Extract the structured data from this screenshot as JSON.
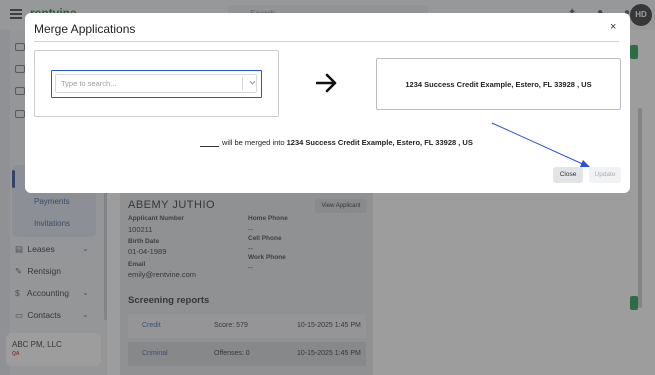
{
  "app": {
    "brand": "rentvine",
    "search_placeholder": "Search",
    "search_shortcut": "⌘K",
    "user_initials": "HD"
  },
  "sidebar": {
    "sub_items": [
      {
        "label": "Payments"
      },
      {
        "label": "Invitations"
      }
    ],
    "items": [
      {
        "label": "Leases",
        "icon": "leases-icon",
        "has_chevron": true
      },
      {
        "label": "Rentsign",
        "icon": "rentsign-icon",
        "has_chevron": false
      },
      {
        "label": "Accounting",
        "icon": "dollar-icon",
        "has_chevron": true
      },
      {
        "label": "Contacts",
        "icon": "contacts-icon",
        "has_chevron": true
      }
    ],
    "company": {
      "name": "ABC PM, LLC",
      "tag": "QA"
    }
  },
  "applicant": {
    "name": "ABEMY JUTHIO",
    "view_button": "View Applicant",
    "fields": [
      {
        "label": "Applicant Number",
        "value": "100211"
      },
      {
        "label": "Birth Date",
        "value": "01-04-1989"
      },
      {
        "label": "Email",
        "value": "emily@rentvine.com"
      },
      {
        "label": "Home Phone",
        "value": "--"
      },
      {
        "label": "Cell Phone",
        "value": "--"
      },
      {
        "label": "Work Phone",
        "value": "--"
      }
    ]
  },
  "screening": {
    "title": "Screening reports",
    "reports": [
      {
        "type": "Credit",
        "result": "Score: 579",
        "date": "10-15-2025 1:45 PM"
      },
      {
        "type": "Criminal",
        "result": "Offenses: 0",
        "date": "10-15-2025 1:45 PM"
      }
    ]
  },
  "modal": {
    "title": "Merge Applications",
    "search_placeholder": "Type to search...",
    "target_label": "1234 Success Credit Example, Estero, FL 33928 , US",
    "merge_text": "will be merged into",
    "merge_target": "1234 Success Credit Example, Estero, FL 33928 , US",
    "close_label": "Close",
    "update_label": "Update",
    "close_icon": "×"
  },
  "colors": {
    "accent": "#2b58c9",
    "brand_green": "#1a7f3c",
    "link": "#3d63b8"
  }
}
